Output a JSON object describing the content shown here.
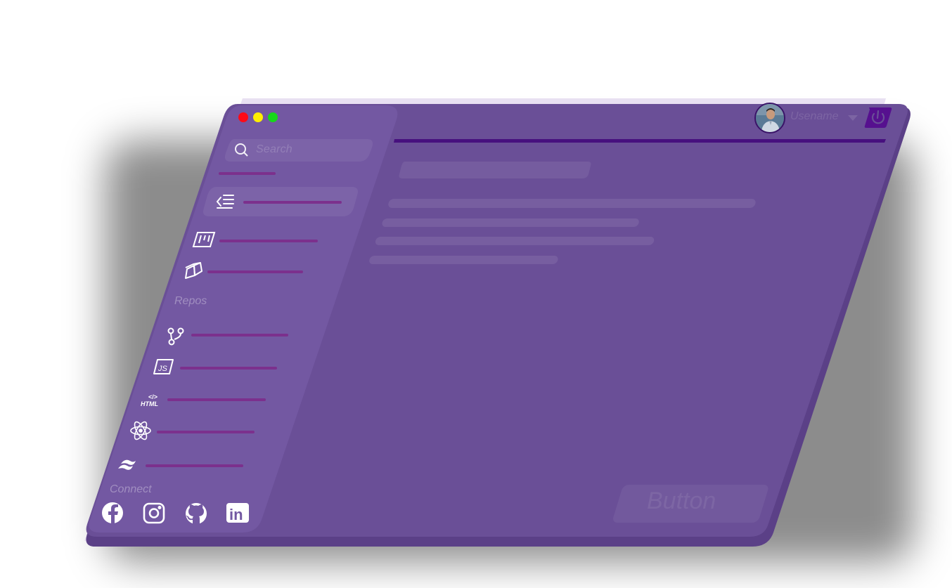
{
  "window": {
    "traffic_lights": [
      "#ff0a17",
      "#ffee00",
      "#16d81a"
    ]
  },
  "colors": {
    "panel": "#6a4f97",
    "sidebar": "#7358a2",
    "edge": "#5b4087",
    "accent_line": "#47107e",
    "sidebar_line": "#7c308d",
    "power": "#56108f"
  },
  "search": {
    "placeholder": "Search",
    "icon": "search-icon"
  },
  "sidebar": {
    "collapse_icon": "menu-collapse-icon",
    "items": [
      {
        "icon": "kanban-board-icon"
      },
      {
        "icon": "package-cube-icon"
      }
    ],
    "repos_label": "Repos",
    "repos": [
      {
        "icon": "git-branch-icon"
      },
      {
        "icon": "javascript-icon"
      },
      {
        "icon": "html-icon",
        "icon_text": "HTML"
      },
      {
        "icon": "react-icon"
      },
      {
        "icon": "tailwind-icon"
      }
    ],
    "connect_label": "Connect",
    "socials": [
      {
        "icon": "facebook-icon"
      },
      {
        "icon": "instagram-icon"
      },
      {
        "icon": "github-icon"
      },
      {
        "icon": "linkedin-icon",
        "icon_text": "in"
      }
    ]
  },
  "header": {
    "username": "Usename",
    "user_menu_icon": "caret-down-icon",
    "power_icon": "power-icon"
  },
  "main": {
    "button_label": "Button"
  }
}
